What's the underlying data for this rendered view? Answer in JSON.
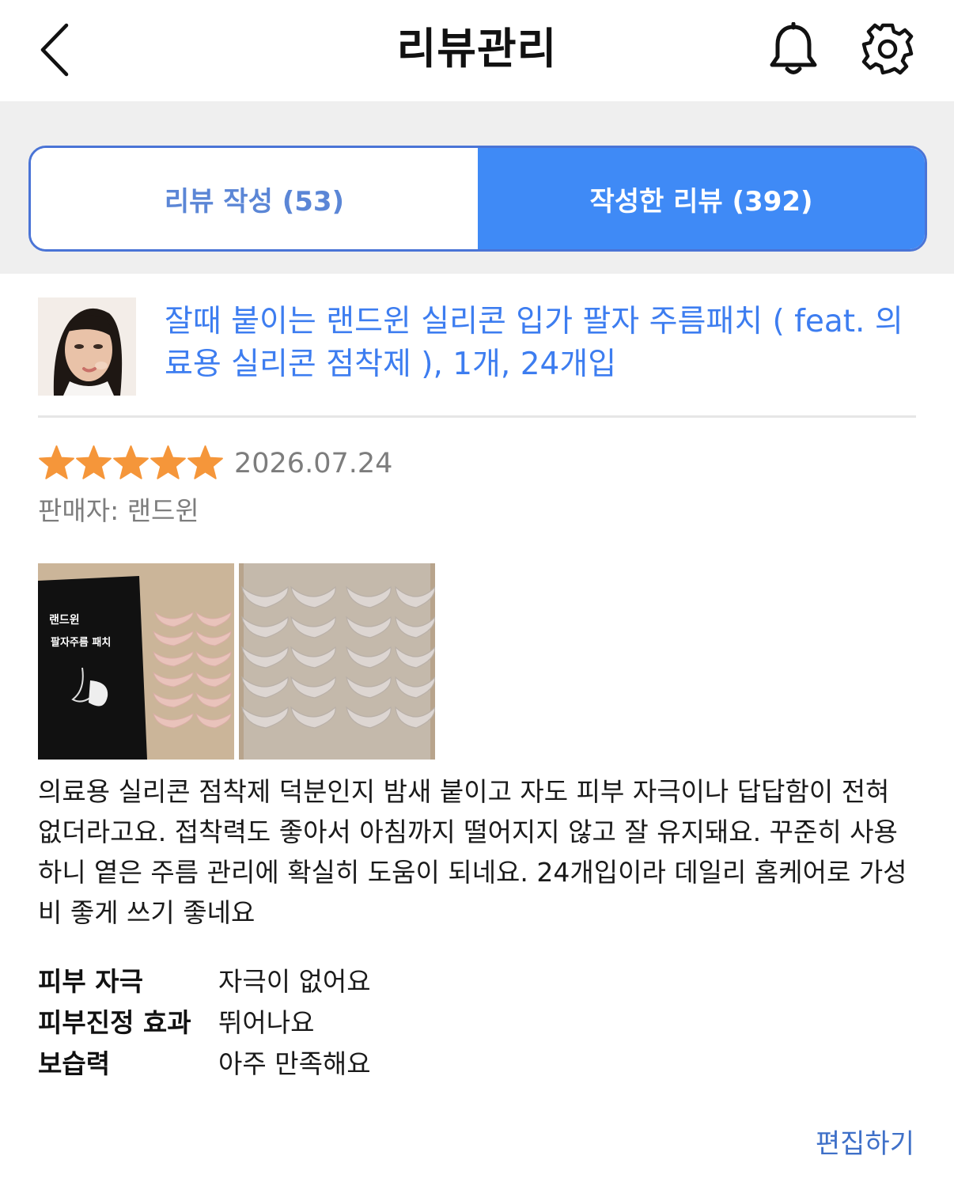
{
  "header": {
    "title": "리뷰관리",
    "back_icon": "chevron-left-icon",
    "bell_icon": "bell-icon",
    "settings_icon": "gear-icon"
  },
  "tabs": [
    {
      "label": "리뷰 작성 (53)",
      "active": false
    },
    {
      "label": "작성한 리뷰 (392)",
      "active": true
    }
  ],
  "colors": {
    "accent": "#3f8af6",
    "link": "#3d7df0",
    "star": "#f5963a",
    "muted": "#7d7d7d"
  },
  "product": {
    "title": "잘때 붙이는 랜드윈 실리콘 입가 팔자 주름패치 ( feat. 의료용 실리콘 점착제 ), 1개, 24개입"
  },
  "review": {
    "rating": 5,
    "rating_max": 5,
    "date": "2026.07.24",
    "seller_label": "판매자: 랜드윈",
    "photos": [
      {
        "package_brand": "랜드윈",
        "package_name": "팔자주름 패치"
      },
      {}
    ],
    "text": "의료용 실리콘 점착제 덕분인지 밤새 붙이고 자도 피부 자극이나 답답함이 전혀 없더라고요. 접착력도 좋아서 아침까지 떨어지지 않고 잘 유지돼요. 꾸준히 사용하니 옅은 주름 관리에 확실히 도움이 되네요. 24개입이라 데일리 홈케어로 가성비 좋게 쓰기 좋네요",
    "attributes": [
      {
        "key": "피부 자극",
        "value": "자극이 없어요"
      },
      {
        "key": "피부진정 효과",
        "value": "뛰어나요"
      },
      {
        "key": "보습력",
        "value": "아주 만족해요"
      }
    ],
    "edit_label": "편집하기"
  }
}
